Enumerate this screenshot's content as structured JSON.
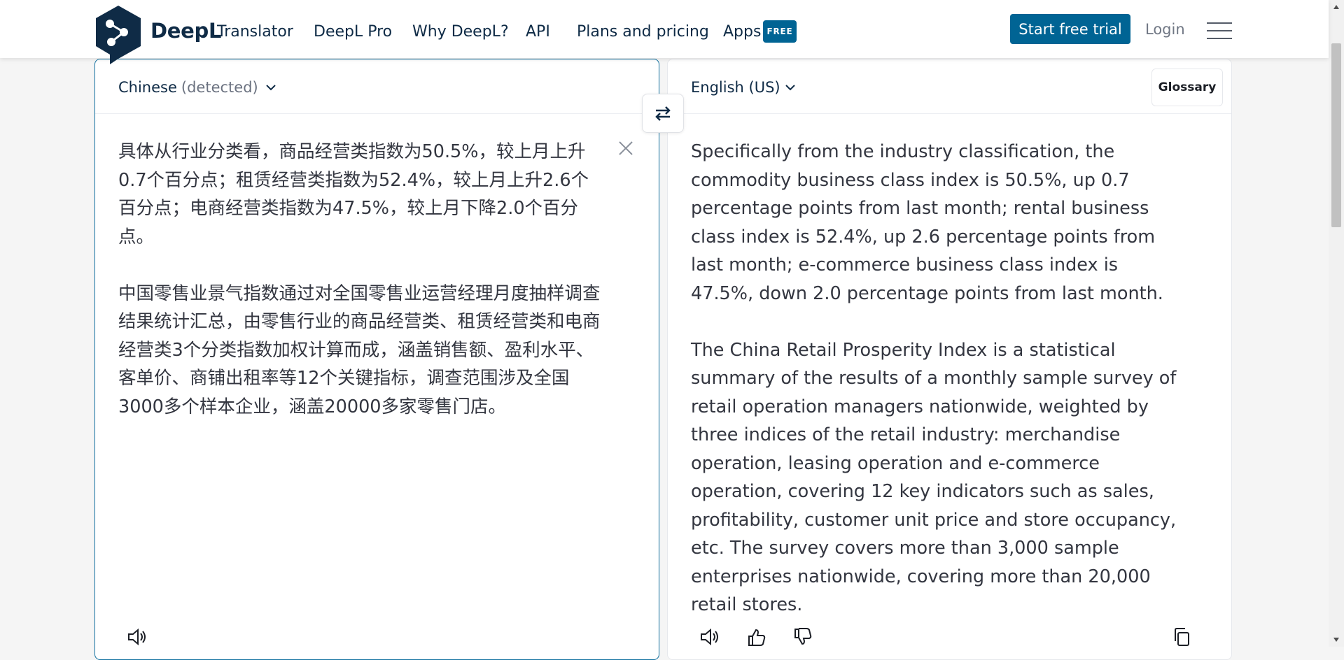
{
  "header": {
    "brand": "DeepL",
    "brand_sub": "Translator",
    "nav": [
      "DeepL Pro",
      "Why DeepL?",
      "API",
      "Plans and pricing",
      "Apps"
    ],
    "free_badge": "FREE",
    "cta": "Start free trial",
    "login": "Login"
  },
  "source": {
    "language": "Chinese",
    "detected": "(detected)",
    "paragraphs": [
      "具体从行业分类看，商品经营类指数为50.5%，较上月上升0.7个百分点；租赁经营类指数为52.4%，较上月上升2.6个百分点；电商经营类指数为47.5%，较上月下降2.0个百分点。",
      "中国零售业景气指数通过对全国零售业运营经理月度抽样调查结果统计汇总，由零售行业的商品经营类、租赁经营类和电商经营类3个分类指数加权计算而成，涵盖销售额、盈利水平、客单价、商铺出租率等12个关键指标，调查范围涉及全国3000多个样本企业，涵盖20000多家零售门店。"
    ]
  },
  "target": {
    "language": "English (US)",
    "glossary": "Glossary",
    "paragraphs": [
      "Specifically from the industry classification, the commodity business class index is 50.5%, up 0.7 percentage points from last month; rental business class index is 52.4%, up 2.6 percentage points from last month; e-commerce business class index is 47.5%, down 2.0 percentage points from last month.",
      "The China Retail Prosperity Index is a statistical summary of the results of a monthly sample survey of retail operation managers nationwide, weighted by three indices of the retail industry: merchandise operation, leasing operation and e-commerce operation, covering 12 key indicators such as sales, profitability, customer unit price and store occupancy, etc. The survey covers more than 3,000 sample enterprises nationwide, covering more than 20,000 retail stores."
    ]
  },
  "icons": {
    "logo": "deepl-logo-icon",
    "menu": "hamburger-menu-icon",
    "swap": "swap-languages-icon",
    "clear": "close-icon",
    "speaker": "speaker-icon",
    "thumbs_up": "thumbs-up-icon",
    "thumbs_down": "thumbs-down-icon",
    "copy": "copy-icon"
  },
  "colors": {
    "brand_navy": "#0f2b46",
    "accent_blue": "#006494"
  }
}
